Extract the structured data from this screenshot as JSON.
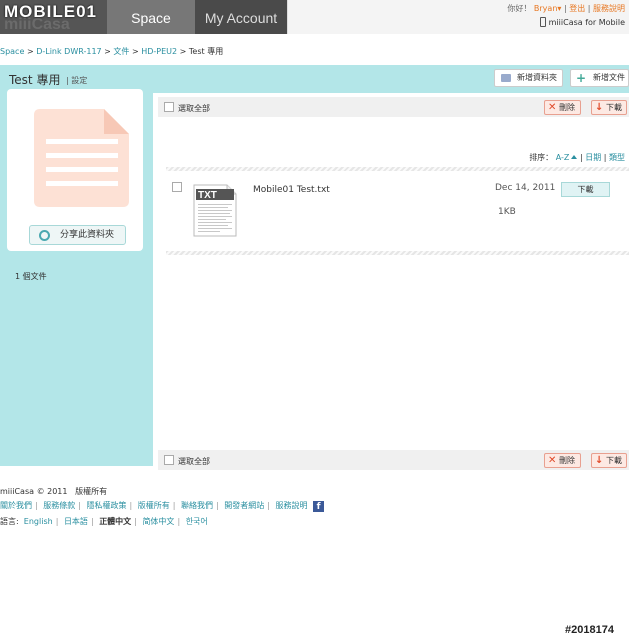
{
  "brand": {
    "watermark_text": "MOBILE01",
    "app_name": "miiiCasa"
  },
  "nav": {
    "space_label": "Space",
    "account_label": "My Account"
  },
  "user_bar": {
    "greeting": "你好！",
    "username": "Bryan",
    "logout": "登出",
    "help": "服務說明",
    "mobile_link": "miiiCasa for Mobile"
  },
  "breadcrumb": {
    "items": [
      "Space",
      "D-Link DWR-117",
      "文件",
      "HD-PEU2",
      "Test 專用"
    ],
    "separator": ">"
  },
  "folder": {
    "title": "Test 專用",
    "setting_label": "設定",
    "new_folder_button": "新增資料夾",
    "new_file_button": "新增文件",
    "share_button": "分享此資料夾",
    "file_count": "1 個文件"
  },
  "toolbar": {
    "select_all": "選取全部",
    "delete_button": "刪除",
    "download_button": "下載"
  },
  "sort": {
    "label": "排序：",
    "options": [
      "A-Z",
      "日期",
      "類型"
    ]
  },
  "files": [
    {
      "name": "Mobile01 Test.txt",
      "type_badge": "TXT",
      "date": "Dec 14, 2011",
      "size": "1KB",
      "download_label": "下載"
    }
  ],
  "footer": {
    "copyright": "miiiCasa © 2011",
    "rights": "版權所有",
    "links": [
      "關於我們",
      "服務條款",
      "隱私權政策",
      "版權所有",
      "聯絡我們",
      "開發者網站",
      "服務說明"
    ],
    "facebook_glyph": "f",
    "language_label": "語言:",
    "languages": [
      "English",
      "日本語",
      "正體中文",
      "简体中文",
      "한국어"
    ],
    "active_language": "正體中文"
  },
  "photo_watermark": "#2018174",
  "colors": {
    "panel_teal": "#b3e6e8",
    "link_teal": "#2a8fa0",
    "accent_orange": "#e87722",
    "danger_red": "#e04a2a",
    "doc_placeholder": "#fde1d5"
  }
}
